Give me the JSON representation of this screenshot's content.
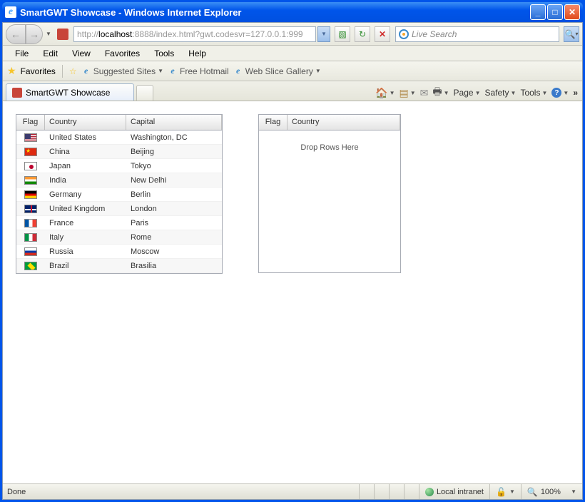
{
  "titlebar": {
    "text": "SmartGWT Showcase - Windows Internet Explorer"
  },
  "address": {
    "prefix": "http://",
    "host": "localhost",
    "rest": ":8888/index.html?gwt.codesvr=127.0.0.1:999"
  },
  "search": {
    "placeholder": "Live Search"
  },
  "menus": [
    "File",
    "Edit",
    "View",
    "Favorites",
    "Tools",
    "Help"
  ],
  "favbar": {
    "label": "Favorites",
    "suggested": "Suggested Sites",
    "hotmail": "Free Hotmail",
    "webslice": "Web Slice Gallery"
  },
  "tab": {
    "title": "SmartGWT Showcase"
  },
  "tabtools": {
    "page": "Page",
    "safety": "Safety",
    "tools": "Tools"
  },
  "grid_left": {
    "cols": {
      "flag": "Flag",
      "country": "Country",
      "capital": "Capital"
    },
    "rows": [
      {
        "flag": "us",
        "country": "United States",
        "capital": "Washington, DC"
      },
      {
        "flag": "cn",
        "country": "China",
        "capital": "Beijing"
      },
      {
        "flag": "jp",
        "country": "Japan",
        "capital": "Tokyo"
      },
      {
        "flag": "in",
        "country": "India",
        "capital": "New Delhi"
      },
      {
        "flag": "de",
        "country": "Germany",
        "capital": "Berlin"
      },
      {
        "flag": "gb",
        "country": "United Kingdom",
        "capital": "London"
      },
      {
        "flag": "fr",
        "country": "France",
        "capital": "Paris"
      },
      {
        "flag": "it",
        "country": "Italy",
        "capital": "Rome"
      },
      {
        "flag": "ru",
        "country": "Russia",
        "capital": "Moscow"
      },
      {
        "flag": "br",
        "country": "Brazil",
        "capital": "Brasilia"
      }
    ]
  },
  "grid_right": {
    "cols": {
      "flag": "Flag",
      "country": "Country"
    },
    "empty": "Drop Rows Here"
  },
  "status": {
    "done": "Done",
    "zone": "Local intranet",
    "zoom": "100%"
  }
}
